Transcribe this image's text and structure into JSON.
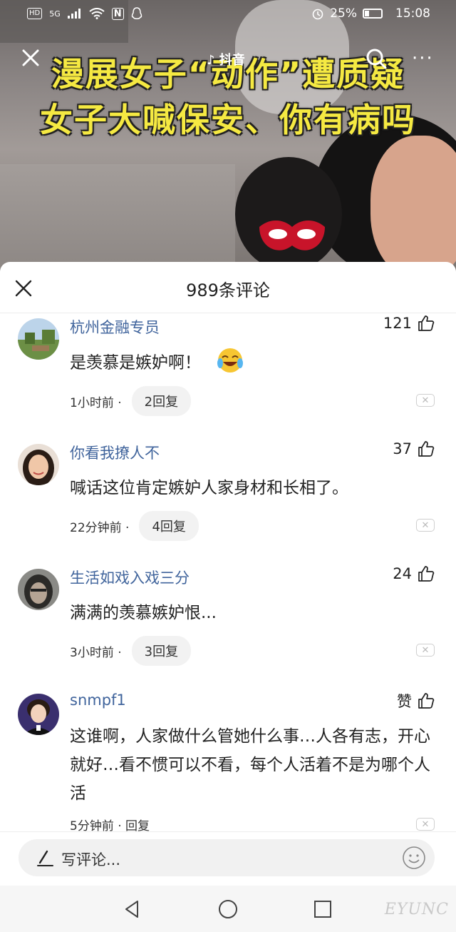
{
  "status_bar": {
    "hd": "HD",
    "network": "5G",
    "nfc": "N",
    "battery": "25%",
    "time": "15:08"
  },
  "video": {
    "caption_line1": "漫展女子“动作”遭质疑",
    "caption_line2": "女子大喊保安、你有病吗",
    "logo_text": "抖音"
  },
  "sheet": {
    "title": "989条评论"
  },
  "comments": [
    {
      "user": "杭州金融专员",
      "likes": "121",
      "text": "是羡慕是嫉妒啊！",
      "time": "1小时前 ·",
      "replies": "2回复"
    },
    {
      "user": "你看我撩人不",
      "likes": "37",
      "text": "喊话这位肯定嫉妒人家身材和长相了。",
      "time": "22分钟前 ·",
      "replies": "4回复"
    },
    {
      "user": "生活如戏入戏三分",
      "likes": "24",
      "text": "满满的羡慕嫉妒恨...",
      "time": "3小时前 ·",
      "replies": "3回复"
    },
    {
      "user": "snmpf1",
      "likes": "赞",
      "text": "这谁啊，人家做什么管她什么事…人各有志，开心就好…看不惯可以不看，每个人活着不是为哪个人活",
      "time": "5分钟前 · 回复"
    }
  ],
  "input": {
    "placeholder": "写评论..."
  },
  "watermark": "EYUNC"
}
